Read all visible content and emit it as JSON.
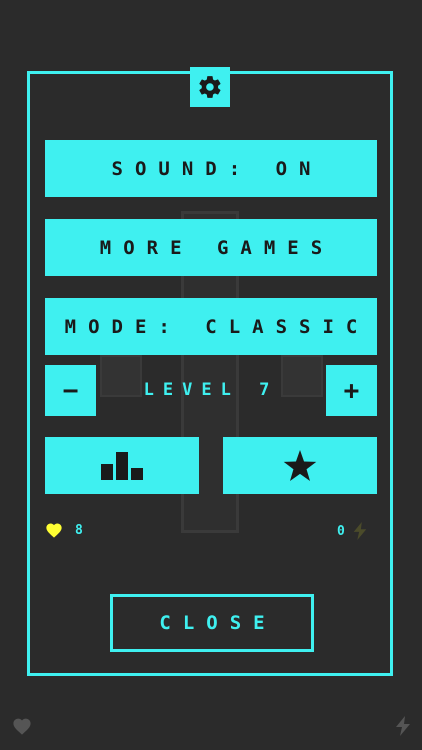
{
  "colors": {
    "accent": "#3ff0f0",
    "background": "#2b2b2b",
    "heart": "#ffff33",
    "bolt_dim": "#4b4b2a"
  },
  "menu": {
    "sound_label": "SOUND: ON",
    "more_games_label": "MORE GAMES",
    "mode_label": "MODE: CLASSIC",
    "level_label": "LEVEL 7",
    "minus_label": "−",
    "plus_label": "+",
    "leaderboard_icon": "leaderboard-icon",
    "rate_icon": "star-icon",
    "settings_icon": "gear-icon"
  },
  "stats": {
    "lives": "8",
    "energy": "0"
  },
  "close_label": "CLOSE"
}
